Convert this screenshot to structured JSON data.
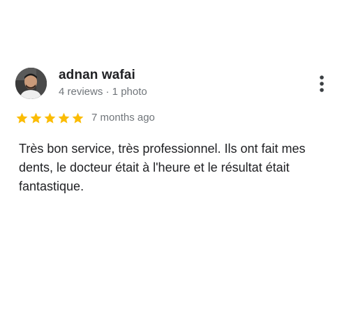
{
  "review": {
    "author_name": "adnan wafai",
    "author_meta": "4 reviews · 1 photo",
    "rating": 5,
    "rating_max": 5,
    "date": "7 months ago",
    "text": "Très bon service, très professionnel. Ils ont fait mes dents, le docteur était à l'heure et le résultat était fantastique."
  },
  "icons": {
    "avatar": "user-avatar-photo",
    "menu": "more-vert-icon",
    "star": "star-icon"
  },
  "colors": {
    "star": "#fbbc04",
    "text_primary": "#202124",
    "text_secondary": "#70757a",
    "menu_dots": "#3c4043"
  }
}
